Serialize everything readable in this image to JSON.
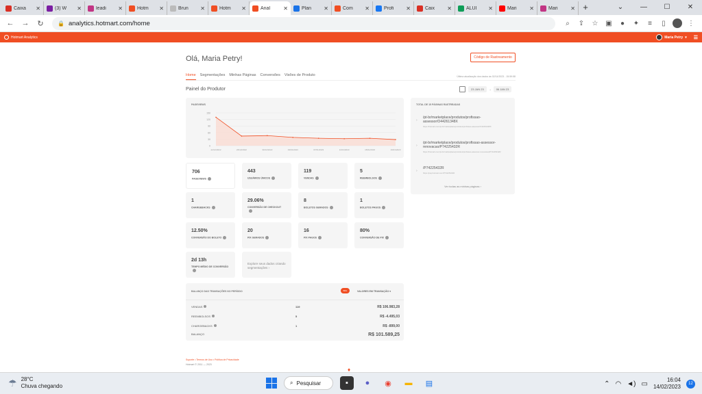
{
  "browser": {
    "tabs": [
      {
        "label": "Caixa",
        "color": "#d93025"
      },
      {
        "label": "(3) W",
        "color": "#7b1fa2"
      },
      {
        "label": "leadi",
        "color": "#c13584"
      },
      {
        "label": "Hotm",
        "color": "#f04e23"
      },
      {
        "label": "Brun",
        "color": "#bbbbbb"
      },
      {
        "label": "Hotm",
        "color": "#f04e23"
      },
      {
        "label": "Anal",
        "color": "#f04e23",
        "active": true
      },
      {
        "label": "Plan",
        "color": "#1a73e8"
      },
      {
        "label": "Com",
        "color": "#f04e23"
      },
      {
        "label": "Profi",
        "color": "#1877f2"
      },
      {
        "label": "Caix",
        "color": "#d93025"
      },
      {
        "label": "ALUI",
        "color": "#0f9d58"
      },
      {
        "label": "Mari",
        "color": "#ff0000"
      },
      {
        "label": "Mari",
        "color": "#c13584"
      }
    ],
    "url": "analytics.hotmart.com/home"
  },
  "header": {
    "brand": "Hotmart Analytics",
    "user": "Maria Petry"
  },
  "page": {
    "greeting": "Olá, Maria Petry!",
    "track_button": "Código de Rastreamento",
    "tabs": [
      "Home",
      "Segmentações",
      "Minhas Páginas",
      "Conversões",
      "Visões de Produto"
    ],
    "last_update": "Última atualização dos dados às 02/14/2023 - 15:59:58",
    "panel_title": "Painel do Produtor",
    "date_from": "23 JAN 23",
    "date_to": "06 JAN 23"
  },
  "chart_data": {
    "type": "area",
    "title": "PAGEVIEWS",
    "x": [
      "22/12/2022",
      "26/12/2022",
      "30/12/2022",
      "03/01/2023",
      "07/01/2023",
      "11/01/2023",
      "15/01/2023",
      "19/01/2023"
    ],
    "ytick_labels": [
      "150",
      "120",
      "90",
      "60",
      "30",
      "0"
    ],
    "values": [
      130,
      44,
      46,
      38,
      34,
      32,
      34,
      28
    ],
    "ylim": [
      0,
      150
    ],
    "color": "#f04e23"
  },
  "metrics": [
    {
      "value": "706",
      "label": "PAGEVIEWS"
    },
    {
      "value": "443",
      "label": "USUÁRIOS ÚNICOS"
    },
    {
      "value": "119",
      "label": "VENDAS"
    },
    {
      "value": "5",
      "label": "REEMBOLSOS"
    },
    {
      "value": "1",
      "label": "CHARGEBACKS"
    },
    {
      "value": "29.06%",
      "label": "CONVERSÃO DE CHECKOUT"
    },
    {
      "value": "8",
      "label": "BOLETOS GERADOS"
    },
    {
      "value": "1",
      "label": "BOLETOS PAGOS"
    },
    {
      "value": "12.50%",
      "label": "CONVERSÃO DO BOLETO"
    },
    {
      "value": "20",
      "label": "PIX GERADOS"
    },
    {
      "value": "16",
      "label": "PIX PAGOS"
    },
    {
      "value": "80%",
      "label": "CONVERSÃO DE PIX"
    },
    {
      "value": "2d 13h",
      "label": "TEMPO MÉDIO DE CONVERSÃO"
    }
  ],
  "explore_cta": "Explore seus dados criando segmentações",
  "tracked_pages": {
    "title": "TOTAL DE 15 PÁGINAS RASTREADAS",
    "items": [
      {
        "path": "/pt-br/marketplace/produtos/profissao-assessor/O44261348X",
        "full": "https://hotmart.com/pt-br/marketplace/produtos/profissao-assessor/O44261348X"
      },
      {
        "path": "/pt-br/marketplace/produtos/profissao-assessor-renovacao/P74225432R",
        "full": "https://hotmart.com/pt-br/marketplace/produtos/profissao-assessor-renovacao/P74225432R"
      },
      {
        "path": "/P74225432R",
        "full": "https://pay.hotmart.com/P74225432R"
      }
    ],
    "more": "Ver todas as minhas páginas"
  },
  "balance": {
    "title": "BALANÇO DAS TRANSAÇÕES NO PERÍODO",
    "currency": "BRL",
    "switch": "VALORES EM TRANSAÇÃO",
    "rows": [
      {
        "label": "VENDAS",
        "count": "119",
        "amount": "R$ 106.983,28"
      },
      {
        "label": "REEMBOLSOS",
        "count": "5",
        "amount": "R$ -4.495,03"
      },
      {
        "label": "CHARGEBACKS",
        "count": "1",
        "amount": "R$ -899,00"
      }
    ],
    "total_label": "BALANÇO",
    "total_amount": "R$ 101.589,25"
  },
  "footer": {
    "links": "Suporte  •  Termos de Uso  •  Política de Privacidade",
    "copyright": "Hotmart © 2011 — 2023"
  },
  "taskbar": {
    "temperature": "28°C",
    "condition": "Chuva chegando",
    "search": "Pesquisar",
    "time": "16:04",
    "date": "14/02/2023",
    "notifications": "12"
  }
}
